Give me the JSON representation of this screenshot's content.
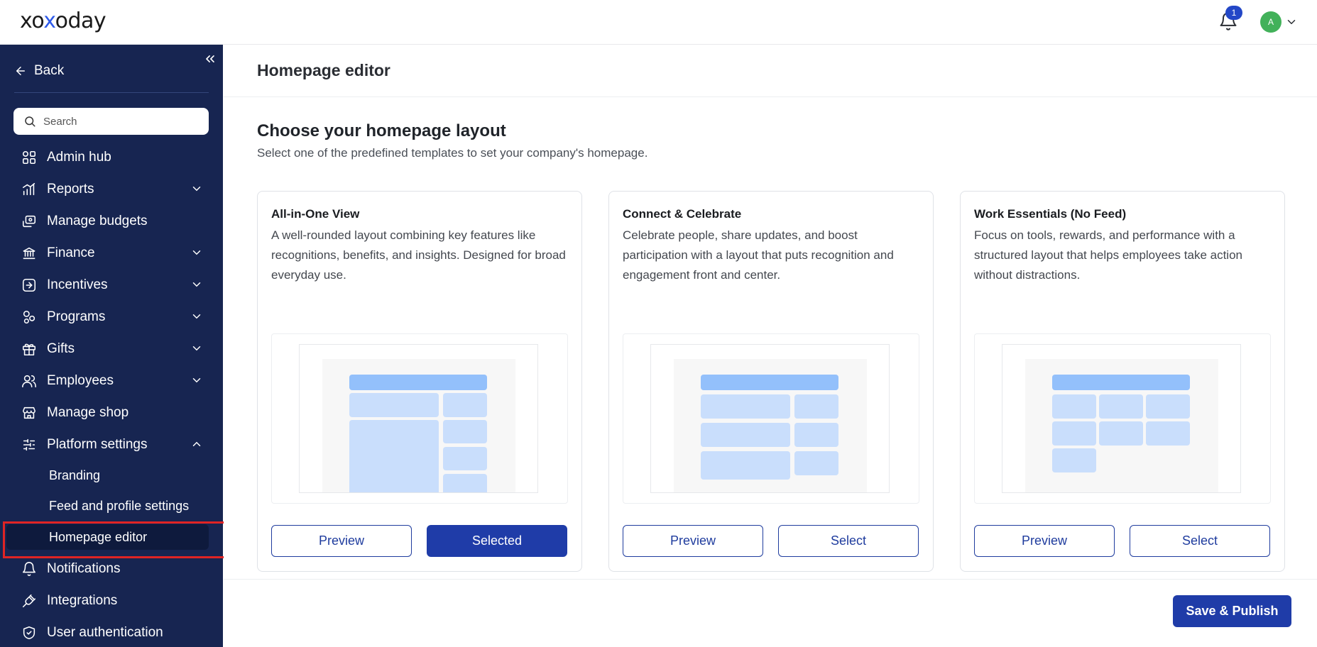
{
  "app": {
    "logo_text_a": "xo",
    "logo_text_x": "x",
    "logo_text_b": "oday"
  },
  "topbar": {
    "notification_count": "1",
    "avatar_initial": "A"
  },
  "sidebar": {
    "back_label": "Back",
    "search_placeholder": "Search",
    "items": [
      {
        "label": "Admin hub",
        "icon": "grid-icon",
        "expandable": false
      },
      {
        "label": "Reports",
        "icon": "bar-chart-icon",
        "expandable": true
      },
      {
        "label": "Manage budgets",
        "icon": "budget-icon",
        "expandable": false
      },
      {
        "label": "Finance",
        "icon": "bank-icon",
        "expandable": true
      },
      {
        "label": "Incentives",
        "icon": "incentive-icon",
        "expandable": true
      },
      {
        "label": "Programs",
        "icon": "programs-icon",
        "expandable": true
      },
      {
        "label": "Gifts",
        "icon": "gift-icon",
        "expandable": true
      },
      {
        "label": "Employees",
        "icon": "users-icon",
        "expandable": true
      },
      {
        "label": "Manage shop",
        "icon": "shop-icon",
        "expandable": false
      },
      {
        "label": "Platform settings",
        "icon": "sliders-icon",
        "expandable": true,
        "expanded": true
      }
    ],
    "sub_items": [
      {
        "label": "Branding"
      },
      {
        "label": "Feed and profile settings"
      },
      {
        "label": "Homepage editor",
        "active": true
      }
    ],
    "bottom_items": [
      {
        "label": "Notifications",
        "icon": "bell-icon"
      },
      {
        "label": "Integrations",
        "icon": "plug-icon"
      },
      {
        "label": "User authentication",
        "icon": "shield-icon"
      }
    ]
  },
  "main": {
    "page_title": "Homepage editor",
    "section_title": "Choose your homepage layout",
    "section_subtitle": "Select one of the predefined templates to set your company's homepage.",
    "cards": [
      {
        "title": "All-in-One View",
        "description": "A well-rounded layout combining key features like recognitions, benefits, and insights. Designed for broad everyday use.",
        "preview_label": "Preview",
        "select_label": "Selected",
        "selected": true
      },
      {
        "title": "Connect & Celebrate",
        "description": "Celebrate people, share updates, and boost participation with a layout that puts recognition and engagement front and center.",
        "preview_label": "Preview",
        "select_label": "Select",
        "selected": false
      },
      {
        "title": "Work Essentials (No Feed)",
        "description": "Focus on tools, rewards, and performance with a structured layout that helps employees take action without distractions.",
        "preview_label": "Preview",
        "select_label": "Select",
        "selected": false
      }
    ],
    "save_label": "Save & Publish"
  },
  "colors": {
    "sidebar_bg": "#172551",
    "accent": "#1f3ca8",
    "highlight": "#e02424",
    "badge": "#2347c7",
    "avatar": "#42b15a"
  }
}
